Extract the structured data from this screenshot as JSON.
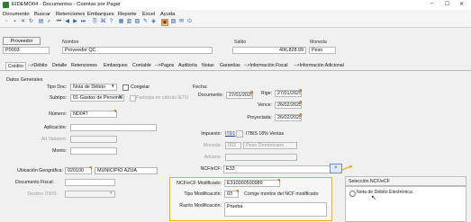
{
  "window": {
    "title": "EIDEMO04 - Documentos - Cuentas por Pagar",
    "controls": [
      "–",
      "☐",
      "✕"
    ]
  },
  "menu": [
    "Documento",
    "Buscar",
    "Retenciones",
    "Embarques",
    "Reporte",
    "Excel",
    "Ayuda"
  ],
  "header": {
    "proveedor_button": "Proveedor",
    "proveedor_code": "P0003",
    "nombre_label": "Nombre",
    "nombre_value": "Proveedor QC",
    "saldo_label": "Saldo",
    "saldo_value": "406,828.99",
    "moneda_label": "Moneda",
    "moneda_value": "Peso"
  },
  "tabs": [
    "Crédito",
    "-->Débito",
    "Detalle",
    "Retenciones",
    "Embarques",
    "Contable",
    "-->Pagos",
    "Auditoría",
    "Notas",
    "Garantías",
    "-->Información Fiscal",
    "-->Información Adicional"
  ],
  "general": {
    "section_title": "Datos Generales",
    "tipo_doc_label": "Tipo Doc:",
    "tipo_doc_value": "Nota de Débito",
    "congelar_label": "Congelar",
    "subtipo_label": "Subtipo:",
    "subtipo_value": "01-Gastos de Personal",
    "participa_label": "Participa en cálculo IETU",
    "numero_label": "Número:",
    "numero_value": "ND047",
    "aplicacion_label": "Aplicación:",
    "ad_valorem_label": "Ad Valorem:",
    "monto_label": "Monto:"
  },
  "fechas": {
    "section_title": "Fecha:",
    "documento_label": "Documento:",
    "documento_value": "27/01/2025",
    "rige_label": "Rige:",
    "rige_value": "27/01/2025",
    "vence_label": "Vence:",
    "vence_value": "26/02/2025",
    "proyectada_label": "Proyectada:",
    "proyectada_value": "26/02/2025"
  },
  "impuesto": {
    "label": "Impuesto:",
    "code": "ITD1",
    "description": "ITBIS 18% Ventas",
    "moneda_label": "Moneda:",
    "moneda_code": "002",
    "moneda_desc": "Peso Dominicano",
    "aduana_label": "Aduana:"
  },
  "ubicacion": {
    "label": "Ubicación Geográfica:",
    "code": "020100",
    "name": "MUNICIPIO AZUA"
  },
  "documento_fiscal_label": "Documento Fiscal:",
  "destino_label": "Destino ITBIS:",
  "ncf": {
    "label": "NCF/eCF:",
    "value": "E33",
    "modificado_label": "NCF/eCF Modificado:",
    "modificado_value": "E310000500989",
    "tipo_mod_label": "Tipo Modificación:",
    "tipo_mod_code": "03",
    "tipo_mod_desc": "Corrige montos del NCF modificado",
    "razon_label": "Razón Modificación:",
    "razon_value": "Prueba"
  },
  "popup": {
    "title": "Selección NCF/eCF",
    "option": "Nota de Débito Electrónica"
  },
  "colors": {
    "highlight_border": "#e8b400",
    "popup_arrow": "#e8b400"
  }
}
